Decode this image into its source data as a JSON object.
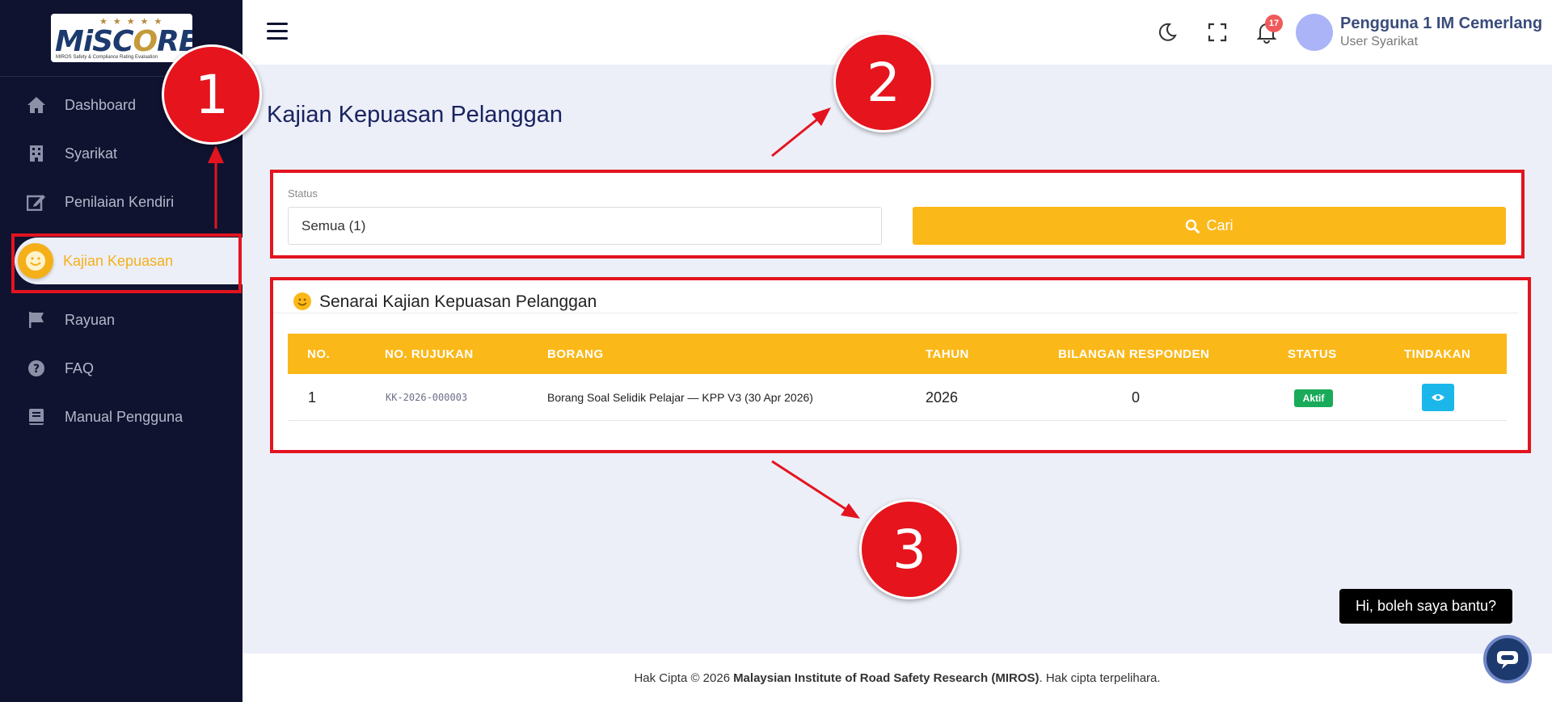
{
  "logo": {
    "text_main": "MiSC",
    "text_accent": "O",
    "text_end": "RE",
    "stars": "★★★★★",
    "subtitle": "MIROS Safety & Compliance Rating Evaluation"
  },
  "sidebar": {
    "items": [
      {
        "label": "Dashboard",
        "icon": "home-icon"
      },
      {
        "label": "Syarikat",
        "icon": "building-icon"
      },
      {
        "label": "Penilaian Kendiri",
        "icon": "edit-icon"
      },
      {
        "label": "Kajian Kepuasan",
        "icon": "smile-icon",
        "active": true
      },
      {
        "label": "Rayuan",
        "icon": "flag-icon"
      },
      {
        "label": "FAQ",
        "icon": "question-icon"
      },
      {
        "label": "Manual Pengguna",
        "icon": "book-icon"
      }
    ]
  },
  "topbar": {
    "notification_count": "17",
    "user_name": "Pengguna 1 IM Cemerlang",
    "user_role": "User Syarikat"
  },
  "page": {
    "title": "Kajian Kepuasan Pelanggan"
  },
  "filter": {
    "status_label": "Status",
    "status_value": "Semua (1)",
    "search_label": "Cari"
  },
  "list": {
    "title": "Senarai Kajian Kepuasan Pelanggan",
    "columns": [
      "NO.",
      "NO. RUJUKAN",
      "BORANG",
      "TAHUN",
      "BILANGAN RESPONDEN",
      "STATUS",
      "TINDAKAN"
    ],
    "rows": [
      {
        "no": "1",
        "reference": "KK-2026-000003",
        "form": "Borang Soal Selidik Pelajar — KPP V3 (30 Apr 2026)",
        "year": "2026",
        "respondents": "0",
        "status": "Aktif"
      }
    ]
  },
  "footer": {
    "prefix": "Hak Cipta © 2026",
    "org": "Malaysian Institute of Road Safety Research (MIROS)",
    "suffix": ". Hak cipta terpelihara."
  },
  "chat": {
    "bubble_text": "Hi, boleh saya bantu?"
  },
  "annotations": {
    "callout_1": "1",
    "callout_2": "2",
    "callout_3": "3"
  },
  "colors": {
    "sidebar_bg": "#0f1330",
    "accent": "#fbb819",
    "annotation_red": "#e3141f",
    "status_green": "#1aab5a",
    "view_button": "#1bb7ea"
  }
}
